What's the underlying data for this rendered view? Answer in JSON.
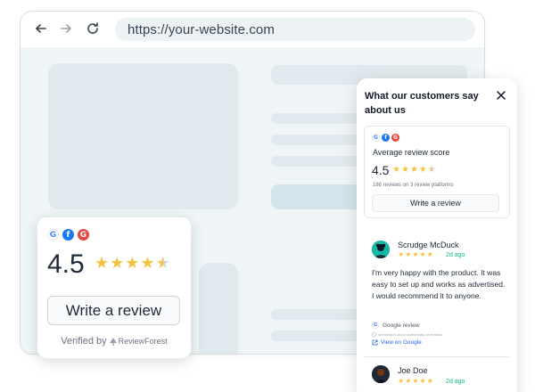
{
  "browser": {
    "url": "https://your-website.com",
    "back_icon": "arrow-left-icon",
    "forward_icon": "arrow-right-icon",
    "reload_icon": "reload-icon"
  },
  "badge": {
    "platforms": [
      "google",
      "facebook",
      "google-reviews"
    ],
    "score": "4.5",
    "rating": 4.5,
    "write_review": "Write a review",
    "verified_by": "Verified by",
    "brand": "ReviewForest"
  },
  "widget": {
    "title": "What our customers say about us",
    "summary": {
      "avg_label": "Average review score",
      "score": "4.5",
      "rating": 4.5,
      "count": "186 reviews on 3 review platforms",
      "write_review": "Write a review"
    },
    "reviews": [
      {
        "name": "Scrudge McDuck",
        "date": "2d ago",
        "rating": 5,
        "text": "I'm very happy with the product. It was easy to set up and works as advertised. I would recommend it to anyone.",
        "source": "Google review",
        "info": "Information about authenticity of reviews",
        "link": "View on Google"
      },
      {
        "name": "Joe Doe",
        "date": "2d ago",
        "rating": 5
      }
    ]
  },
  "colors": {
    "star": "#f5c242",
    "star_empty": "#d1d5db",
    "date": "#10b981",
    "link": "#2563eb"
  }
}
